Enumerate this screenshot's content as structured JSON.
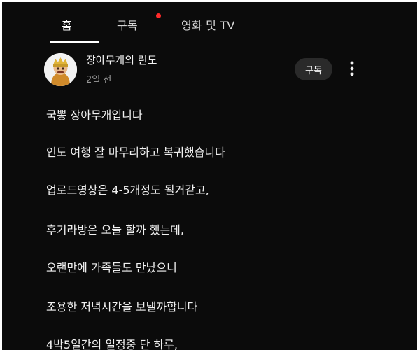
{
  "tabs": [
    {
      "label": "홈",
      "active": true
    },
    {
      "label": "구독",
      "has_notification": true
    },
    {
      "label": "영화 및 TV"
    }
  ],
  "post": {
    "channel_name": "장아무개의 린도",
    "time_ago": "2일 전",
    "subscribe_label": "구독",
    "more_icon": "more-vert-icon",
    "lines": [
      "국뽕 장아무개입니다",
      "인도 여행 잘 마무리하고 복귀했습니다",
      "업로드영상은 4-5개정도 될거같고,",
      "후기라방은 오늘 할까 했는데,",
      "오랜만에 가족들도 만났으니",
      "조용한 저녁시간을 보낼까합니다",
      "4박5일간의 일정중 단 하루,"
    ]
  },
  "colors": {
    "background": "#0b0b0b",
    "notification_dot": "#ff2a2a",
    "button_bg": "#2a2a2a"
  }
}
